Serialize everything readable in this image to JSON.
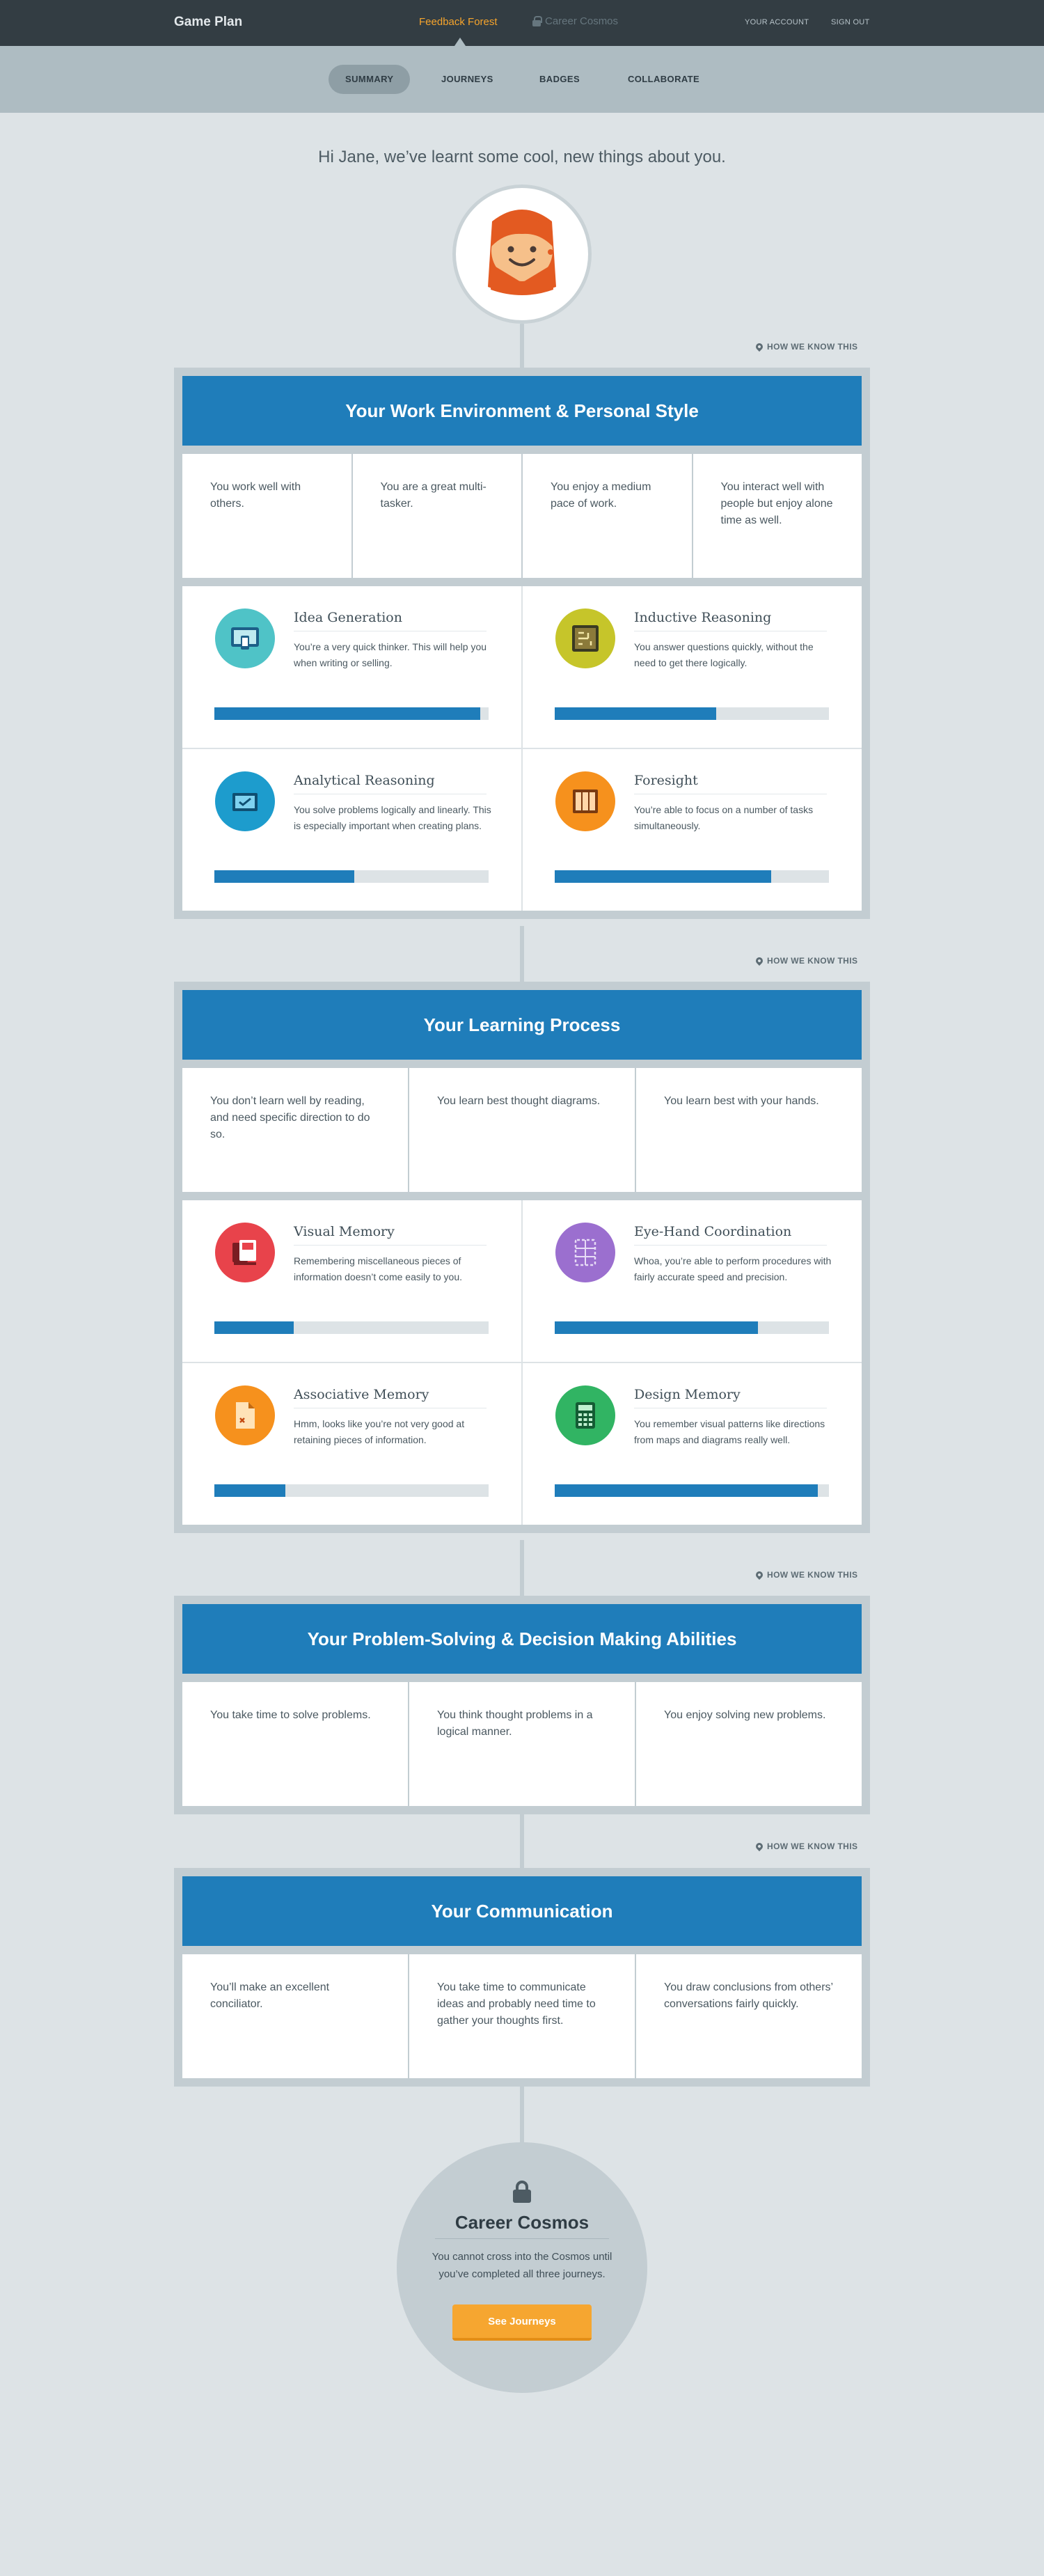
{
  "topbar": {
    "brand": "Game Plan",
    "nav_active": "Feedback Forest",
    "nav_locked": "Career Cosmos",
    "account": "YOUR ACCOUNT",
    "signout": "SIGN OUT"
  },
  "subnav": {
    "tabs": [
      "SUMMARY",
      "JOURNEYS",
      "BADGES",
      "COLLABORATE"
    ]
  },
  "greeting": "Hi Jane, we’ve learnt some cool, new things about you.",
  "how_we_know": "HOW WE KNOW THIS",
  "colors": {
    "topbar": "#333d43",
    "accent_blue": "#1f7dba",
    "accent_orange": "#f6a630"
  },
  "sections": [
    {
      "title": "Your Work Environment & Personal Style",
      "traits": [
        "You work well with others.",
        "You are a great multi-tasker.",
        "You enjoy a medium pace of work.",
        "You interact well with people but enjoy alone time as well."
      ],
      "skills": [
        {
          "title": "Idea Generation",
          "desc": "You’re a very quick thinker. This will help you when writing or selling.",
          "level": 0.97,
          "color": "#4fc3c7",
          "icon": "screen-icon"
        },
        {
          "title": "Inductive Reasoning",
          "desc": "You answer questions quickly, without the need to get there logically.",
          "level": 0.59,
          "color": "#c6c52a",
          "icon": "board-icon"
        },
        {
          "title": "Analytical Reasoning",
          "desc": "You solve problems logically and linearly. This is especially important when creating plans.",
          "level": 0.51,
          "color": "#1d9ccd",
          "icon": "folder-icon"
        },
        {
          "title": "Foresight",
          "desc": "You’re able to focus on a number of tasks simultaneously.",
          "level": 0.79,
          "color": "#f6911d",
          "icon": "columns-icon"
        }
      ]
    },
    {
      "title": "Your Learning Process",
      "traits": [
        "You don’t learn well by reading, and need specific direction to do so.",
        "You learn best thought diagrams.",
        "You learn best with your hands."
      ],
      "skills": [
        {
          "title": "Visual Memory",
          "desc": "Remembering miscellaneous pieces of information doesn’t come easily to you.",
          "level": 0.29,
          "color": "#e8434b",
          "icon": "cards-icon"
        },
        {
          "title": "Eye-Hand Coordination",
          "desc": "Whoa, you’re able to perform procedures with fairly accurate speed and precision.",
          "level": 0.74,
          "color": "#9b6fcf",
          "icon": "grid-icon"
        },
        {
          "title": "Associative Memory",
          "desc": "Hmm, looks like you’re not very good at retaining pieces of information.",
          "level": 0.26,
          "color": "#f6911d",
          "icon": "document-icon"
        },
        {
          "title": "Design Memory",
          "desc": "You remember visual patterns like directions  from maps and diagrams really well.",
          "level": 0.96,
          "color": "#31b463",
          "icon": "calculator-icon"
        }
      ]
    },
    {
      "title": "Your Problem-Solving & Decision Making  Abilities",
      "traits": [
        "You take time to solve problems.",
        "You think thought problems in a logical manner.",
        "You enjoy solving new problems."
      ]
    },
    {
      "title": "Your Communication",
      "traits": [
        "You’ll make an excellent conciliator.",
        "You take time to communicate ideas and probably need time to gather your thoughts first.",
        "You draw conclusions from others’ conversations fairly quickly."
      ]
    }
  ],
  "cosmos": {
    "title": "Career Cosmos",
    "text": "You cannot cross into the Cosmos until you’ve completed all three journeys.",
    "button": "See Journeys"
  }
}
